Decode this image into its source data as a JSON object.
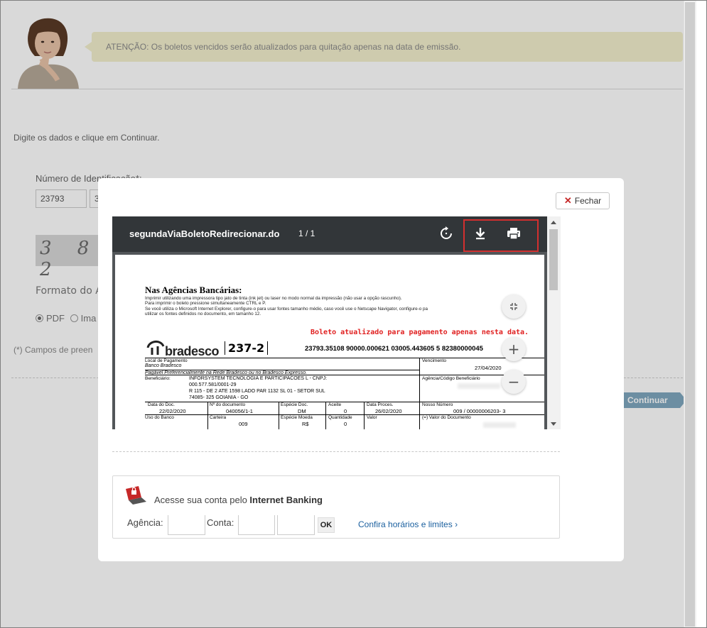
{
  "background": {
    "notice": "ATENÇÃO: Os boletos vencidos serão atualizados para quitação apenas na data de emissão.",
    "instruction": "Digite os dados e clique em Continuar.",
    "id_label": "Número de Identificação*:",
    "id_fields": [
      "23793",
      "3"
    ],
    "captcha_text": "3 8 2",
    "format_label": "Formato do A",
    "format_options": [
      "PDF",
      "Ima"
    ],
    "required_note": "(*) Campos de preen",
    "continue_label": "Continuar"
  },
  "modal": {
    "close_label": "Fechar",
    "pdf": {
      "title": "segundaViaBoletoRedirecionar.do",
      "pages": "1 / 1",
      "heading": "Nas Agências Bancárias:",
      "instructions": [
        "Imprimir utilizando uma impressora tipo jato de tinta (ink jet) ou laser no modo normal da impressão (não usar a opção rascunho).",
        "Para imprimir o boleto pressione simultaneamente CTRL e P.",
        "Se você utiliza o Microsoft Internet Explorer, configure-o para usar fontes tamanho médio, caso você use o Netscape Navigator, configure-o pa",
        "utilizar os fontes definidos no documento, em tamanho 12."
      ],
      "updated_note": "Boleto atualizado para pagamento apenas nesta data.",
      "bank_name": "bradesco",
      "bank_code": "237-2",
      "digitable_line": "23793.35108 90000.000621 03005.443605 5 82380000045",
      "local_label": "Local de Pagamento",
      "local_bank": "Banco Bradesco",
      "local_pref": "Pagável Preferencialmente na Rede Bradesco ou no Bradesco Expresso.",
      "vencimento_label": "Vencimento",
      "vencimento_value": "27/04/2020",
      "beneficiario_label": "Beneficiário:",
      "beneficiario_lines": [
        "INFORSYSTEM TECNOLOGIA E PARTICIPACOES L - CNPJ:",
        "000.577.581/0001-29",
        "R 115 - DE 2 ATE 1598 LADO PAR 1132 SL 01 - SETOR SUL",
        "74085- 325 GOIANIA - GO"
      ],
      "agencia_label": "Agência/Código Beneficiário",
      "row1_labels": [
        "Data do Doc.",
        "Nº do documento",
        "Espécie Doc.",
        "Aceite",
        "Data Proces.",
        "Nosso Número"
      ],
      "row1_values": [
        "22/02/2020",
        "040056/1-1",
        "DM",
        "0",
        "26/02/2020",
        "009 / 00000006203- 3"
      ],
      "row2_labels": [
        "Uso do Banco",
        "Carteira",
        "Espécie Moeda",
        "Quantidade",
        "Valor",
        "(=) Valor do Documento"
      ],
      "row2_values": [
        "",
        "009",
        "R$",
        "0",
        ""
      ]
    },
    "ib": {
      "text_prefix": "Acesse sua conta pelo ",
      "text_bold": "Internet Banking",
      "agencia_label": "Agência:",
      "conta_label": "Conta:",
      "ok_label": "OK",
      "link_label": "Confira horários e limites",
      "link_chevron": "›"
    }
  },
  "colors": {
    "notice_bg": "#f3efcd",
    "toolbar": "#323639",
    "highlight_box": "#d32f2f",
    "updated_note": "#e02020",
    "link": "#1a5f9e",
    "continue_btn": "#7fa7bf"
  },
  "icons": [
    "rotate-icon",
    "download-icon",
    "print-icon",
    "fit-page-icon",
    "zoom-in-icon",
    "zoom-out-icon",
    "close-x-icon",
    "bradesco-logo",
    "laptop-lock-icon",
    "avatar-image"
  ]
}
